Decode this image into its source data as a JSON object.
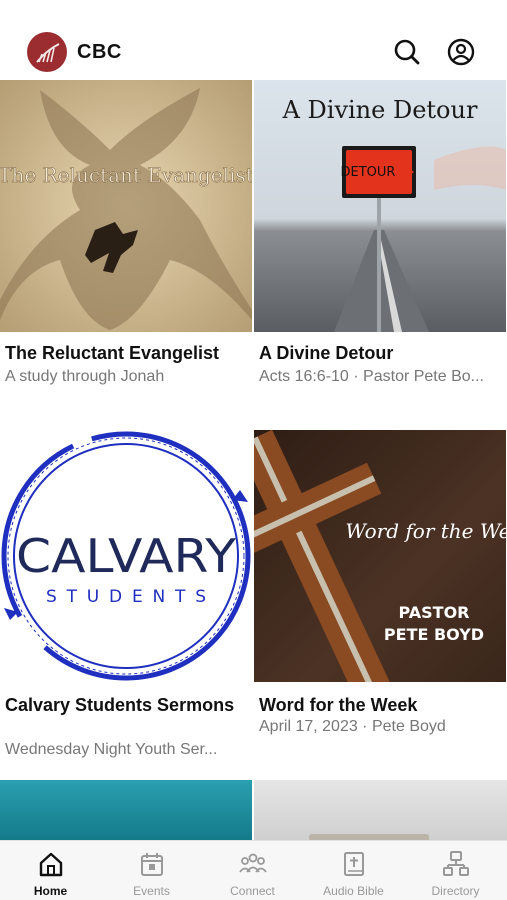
{
  "app": {
    "title": "CBC"
  },
  "cards": [
    {
      "title": "The Reluctant Evangelist",
      "subtitle": "A study through Jonah",
      "thumb_text": "The Reluctant Evangelist"
    },
    {
      "title": "A Divine Detour",
      "subtitle": "Acts 16:6-10 · Pastor Pete Bo...",
      "thumb_text": "A Divine Detour",
      "sign_text": "DETOUR"
    },
    {
      "title": "Calvary Students Sermons",
      "subtitle": "Wednesday Night Youth Ser...",
      "thumb_text": "CALVARY",
      "thumb_text2": "STUDENTS"
    },
    {
      "title": "Word for the Week",
      "subtitle": "April 17, 2023 · Pete Boyd",
      "thumb_text": "Word for the Week",
      "thumb_text2": "PASTOR",
      "thumb_text3": "PETE BOYD"
    }
  ],
  "tabs": [
    {
      "label": "Home",
      "icon": "home-icon",
      "active": true
    },
    {
      "label": "Events",
      "icon": "calendar-icon"
    },
    {
      "label": "Connect",
      "icon": "people-icon"
    },
    {
      "label": "Audio Bible",
      "icon": "bible-icon"
    },
    {
      "label": "Directory",
      "icon": "directory-icon"
    }
  ],
  "colors": {
    "brand": "#9b2d31",
    "accent_blue": "#1f2fbf"
  }
}
